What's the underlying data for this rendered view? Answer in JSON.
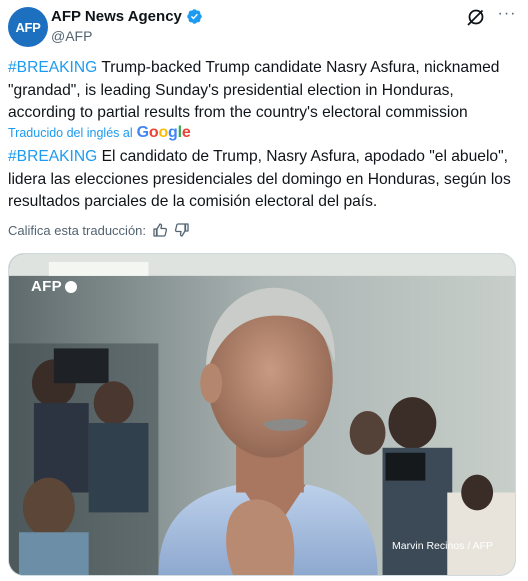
{
  "account": {
    "avatar_text": "AFP",
    "display_name": "AFP News Agency",
    "handle": "@AFP"
  },
  "tweet": {
    "original_tag": "#BREAKING",
    "original_text": " Trump-backed Trump candidate Nasry Asfura, nicknamed \"grandad\", is leading Sunday's presidential election in Honduras, according to partial results from the country's electoral commission",
    "translated_by": "Traducido del inglés al",
    "translator_name": "Google",
    "translation_tag": "#BREAKING",
    "translation_text": " El candidato de Trump, Nasry Asfura, apodado \"el abuelo\", lidera las elecciones presidenciales del domingo en Honduras, según los resultados parciales de la comisión electoral del país.",
    "rate_label": "Califica esta traducción:"
  },
  "media": {
    "logo_text": "AFP",
    "photo_credit": "Marvin Recinos / AFP"
  },
  "icons": {
    "verified": "verified-badge-icon",
    "grok": "grok-icon",
    "more": "more-icon",
    "thumbs_up": "thumbs-up-icon",
    "thumbs_down": "thumbs-down-icon"
  },
  "colors": {
    "accent": "#1d9bf0",
    "text": "#0f1419",
    "secondary": "#536471",
    "avatar_bg": "#1d6fbf"
  }
}
